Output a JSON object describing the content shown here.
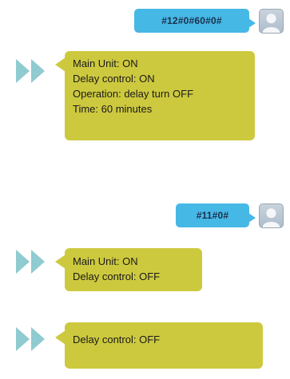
{
  "colors": {
    "sent_bubble": "#46b8e6",
    "received_bubble": "#cdc93f",
    "sender_icon": "#8fcbd0"
  },
  "conversation": [
    {
      "type": "sent",
      "text": "#12#0#60#0#",
      "avatar_icon": "user-avatar-icon"
    },
    {
      "type": "received",
      "sender_icon": "double-chevron-icon",
      "lines": [
        "Main Unit: ON",
        "Delay control: ON",
        "Operation: delay turn OFF",
        "Time: 60 minutes"
      ]
    },
    {
      "type": "sent",
      "text": "#11#0#",
      "avatar_icon": "user-avatar-icon"
    },
    {
      "type": "received",
      "sender_icon": "double-chevron-icon",
      "lines": [
        "Main Unit: ON",
        "Delay control: OFF"
      ]
    },
    {
      "type": "received",
      "sender_icon": "double-chevron-icon",
      "lines": [
        "Delay control: OFF"
      ]
    }
  ]
}
